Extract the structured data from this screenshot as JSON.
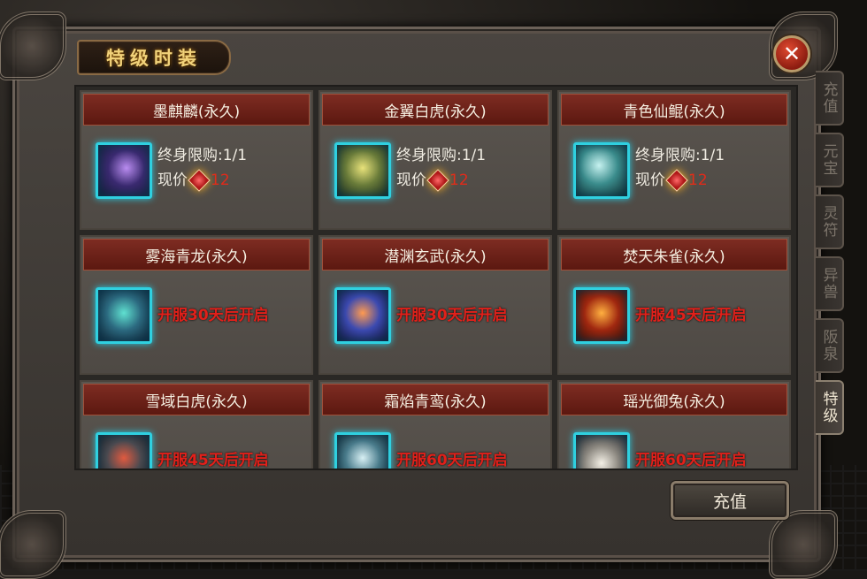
{
  "title": "特级时装",
  "close_icon": "close-icon",
  "side_tabs": [
    "充值",
    "元宝",
    "灵符",
    "异兽",
    "阪泉",
    "特级"
  ],
  "active_tab": "特级",
  "items": [
    {
      "name": "墨麒麟(永久)",
      "limit": "终身限购:1/1",
      "price_label": "现价",
      "price": "12",
      "open": ""
    },
    {
      "name": "金翼白虎(永久)",
      "limit": "终身限购:1/1",
      "price_label": "现价",
      "price": "12",
      "open": ""
    },
    {
      "name": "青色仙鲲(永久)",
      "limit": "终身限购:1/1",
      "price_label": "现价",
      "price": "12",
      "open": ""
    },
    {
      "name": "雾海青龙(永久)",
      "limit": "",
      "price_label": "",
      "price": "",
      "open": "开服30天后开启"
    },
    {
      "name": "潜渊玄武(永久)",
      "limit": "",
      "price_label": "",
      "price": "",
      "open": "开服30天后开启"
    },
    {
      "name": "焚天朱雀(永久)",
      "limit": "",
      "price_label": "",
      "price": "",
      "open": "开服45天后开启"
    },
    {
      "name": "雪域白虎(永久)",
      "limit": "",
      "price_label": "",
      "price": "",
      "open": "开服45天后开启"
    },
    {
      "name": "霜焰青鸾(永久)",
      "limit": "",
      "price_label": "",
      "price": "",
      "open": "开服60天后开启"
    },
    {
      "name": "瑶光御兔(永久)",
      "limit": "",
      "price_label": "",
      "price": "",
      "open": "开服60天后开启"
    }
  ],
  "recharge_button": "充值",
  "colors": {
    "accent_red": "#e2201a",
    "title_gold": "#f1d27a",
    "icon_border": "#2fd0e0"
  }
}
